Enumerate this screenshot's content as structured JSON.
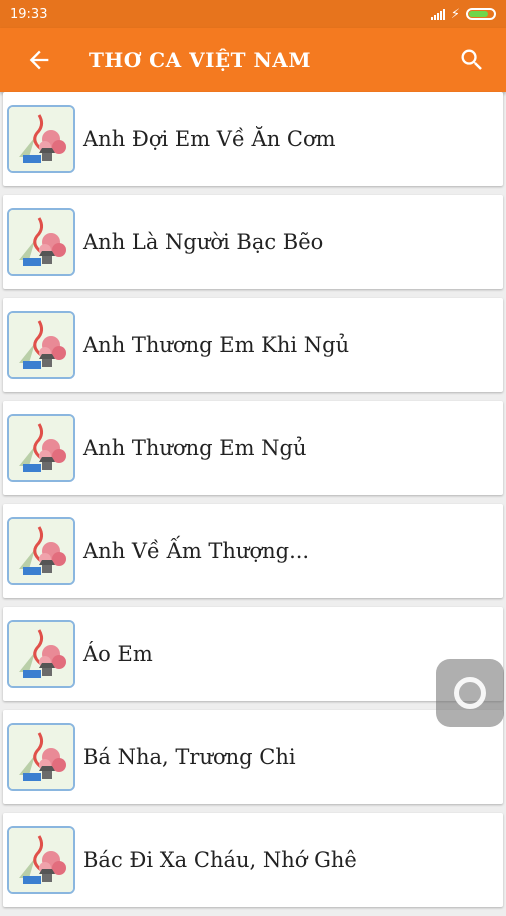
{
  "status_bar": {
    "time": "19:33"
  },
  "app_bar": {
    "title": "THƠ CA VIỆT NAM",
    "back_icon": "arrow-left-icon",
    "search_icon": "search-icon"
  },
  "colors": {
    "primary": "#f47a20",
    "status": "#e7741d",
    "battery": "#6fd64b"
  },
  "poems": [
    {
      "title": "Anh Đợi Em Về Ăn Cơm"
    },
    {
      "title": "Anh Là Người Bạc Bẽo"
    },
    {
      "title": "Anh Thương Em Khi Ngủ"
    },
    {
      "title": "Anh Thương Em Ngủ"
    },
    {
      "title": "Anh Về Ấm Thượng..."
    },
    {
      "title": "Áo Em"
    },
    {
      "title": "Bá Nha, Trương Chi"
    },
    {
      "title": "Bác Đi Xa Cháu, Nhớ Ghê"
    }
  ]
}
